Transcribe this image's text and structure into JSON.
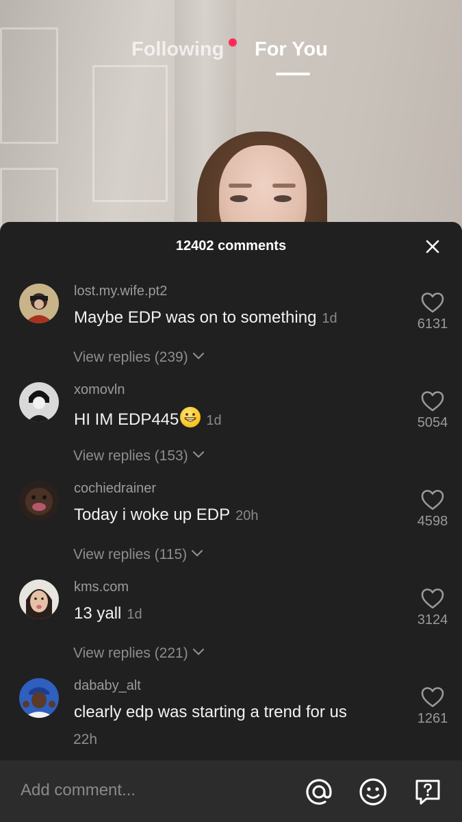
{
  "feed_tabs": {
    "following": "Following",
    "for_you": "For You",
    "active": "For You"
  },
  "comments_sheet": {
    "title": "12402 comments",
    "comments": [
      {
        "username": "lost.my.wife.pt2",
        "text": "Maybe EDP was on to something",
        "time": "1d",
        "replies": "View replies (239)",
        "likes": "6131"
      },
      {
        "username": "xomovln",
        "text": "HI IM EDP445",
        "emoji": "grinning-face-emoji",
        "time": "1d",
        "replies": "View replies (153)",
        "likes": "5054"
      },
      {
        "username": "cochiedrainer",
        "text": "Today i woke up EDP",
        "time": "20h",
        "replies": "View replies (115)",
        "likes": "4598"
      },
      {
        "username": "kms.com",
        "text": "13 yall",
        "time": "1d",
        "replies": "View replies (221)",
        "likes": "3124"
      },
      {
        "username": "dababy_alt",
        "text": "clearly edp was starting a trend for us",
        "time": "22h",
        "likes": "1261"
      }
    ]
  },
  "composer": {
    "placeholder": "Add comment...",
    "icons": [
      "mention-icon",
      "emoji-icon",
      "question-icon"
    ]
  },
  "colors": {
    "sheet_bg": "#202020",
    "bar_bg": "#2c2c2c",
    "live_dot": "#fe2c55"
  }
}
